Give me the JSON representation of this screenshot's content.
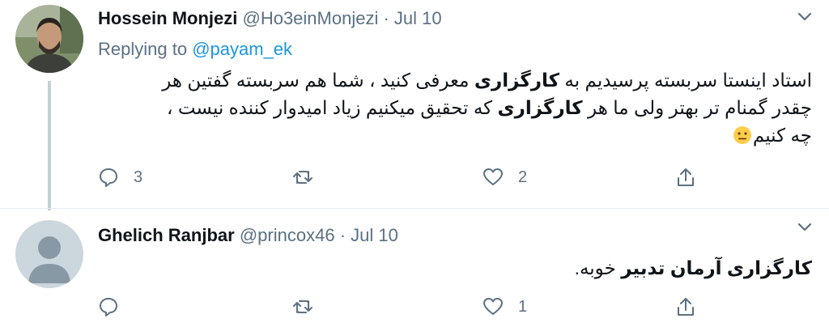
{
  "tweets": [
    {
      "display_name": "Hossein Monjezi",
      "handle": "@Ho3einMonjezi",
      "separator": "·",
      "date": "Jul 10",
      "replying_label": "Replying to",
      "replying_to": "@payam_ek",
      "body": {
        "l1_a": "استاد اینستا سربسته پرسیدیم به ",
        "l1_b": "کارگزاری",
        "l1_c": " معرفی کنید ، شما هم سربسته گفتین هر",
        "l2_a": "چقدر گمنام تر بهتر ولی ما هر ",
        "l2_b": "کارگزاری",
        "l2_c": " که تحقیق میکنیم زیاد امیدوار کننده نیست ،",
        "l3_a": "چه کنیم"
      },
      "emoji": "neutral-face-emoji",
      "actions": {
        "reply_count": "3",
        "retweet_count": "",
        "like_count": "2"
      }
    },
    {
      "display_name": "Ghelich Ranjbar",
      "handle": "@princox46",
      "separator": "·",
      "date": "Jul 10",
      "body": {
        "l1_a": "کارگزاری آرمان تدبیر",
        "l1_b": " خوبه."
      },
      "actions": {
        "reply_count": "",
        "retweet_count": "",
        "like_count": "1"
      }
    }
  ],
  "colors": {
    "muted": "#5b7083",
    "link": "#1b95e0",
    "thread_line": "#c4cfd6"
  }
}
